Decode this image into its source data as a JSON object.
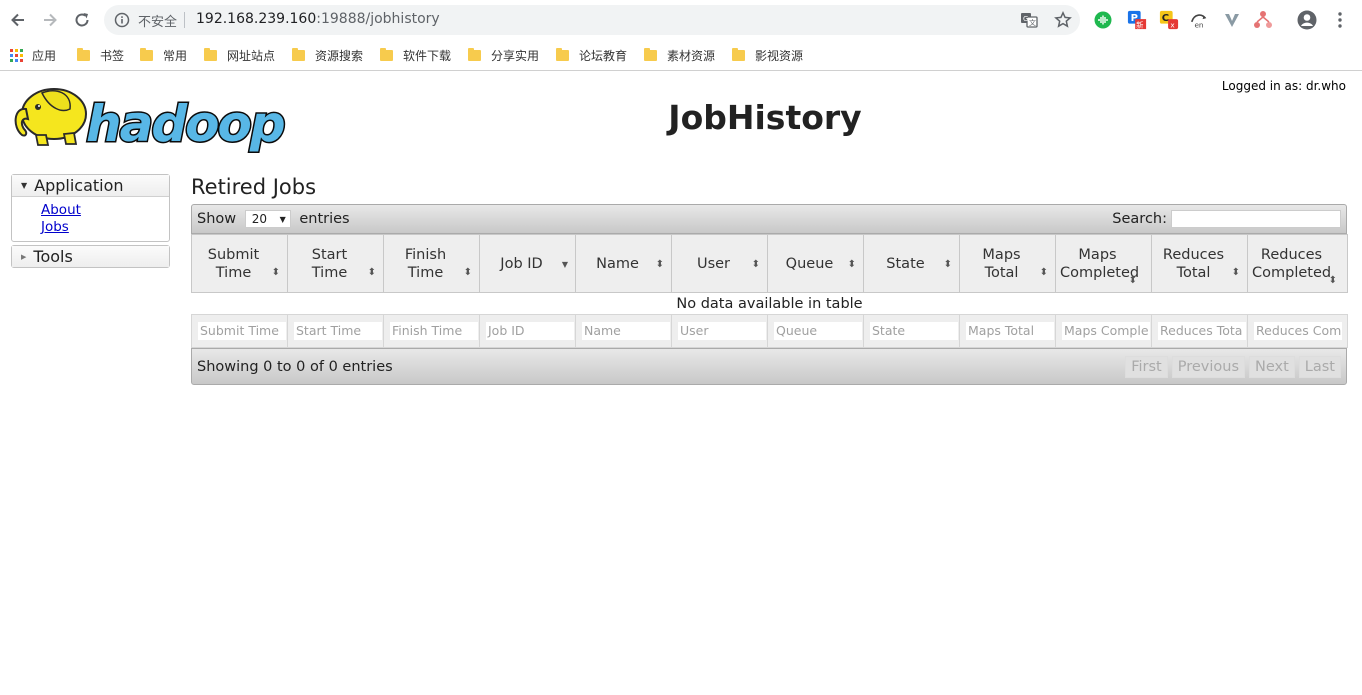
{
  "browser": {
    "security_label": "不安全",
    "url_host": "192.168.239.160",
    "url_rest": ":19888/jobhistory",
    "extensions": [
      "green-sound-extension-icon",
      "p-new-extension-icon",
      "c-red-x-extension-icon",
      "translate-en-extension-icon",
      "v-extension-icon",
      "network-extension-icon"
    ]
  },
  "bookmarks": [
    {
      "label": "应用",
      "icon": "apps-grid-icon"
    },
    {
      "label": "书签",
      "icon": "folder-icon"
    },
    {
      "label": "常用",
      "icon": "folder-icon"
    },
    {
      "label": "网址站点",
      "icon": "folder-icon"
    },
    {
      "label": "资源搜索",
      "icon": "folder-icon"
    },
    {
      "label": "软件下载",
      "icon": "folder-icon"
    },
    {
      "label": "分享实用",
      "icon": "folder-icon"
    },
    {
      "label": "论坛教育",
      "icon": "folder-icon"
    },
    {
      "label": "素材资源",
      "icon": "folder-icon"
    },
    {
      "label": "影视资源",
      "icon": "folder-icon"
    }
  ],
  "header": {
    "logo_text": "hadoop",
    "title": "JobHistory",
    "logged_in": "Logged in as: dr.who"
  },
  "nav": {
    "application": {
      "label": "Application",
      "links": [
        "About",
        "Jobs"
      ]
    },
    "tools": {
      "label": "Tools"
    }
  },
  "main": {
    "section_title": "Retired Jobs",
    "show_label": "Show",
    "page_length": "20",
    "entries_label": "entries",
    "search_label": "Search:",
    "search_value": "",
    "columns": [
      {
        "label": "Submit Time",
        "sort": "both"
      },
      {
        "label": "Start Time",
        "sort": "both"
      },
      {
        "label": "Finish Time",
        "sort": "both"
      },
      {
        "label": "Job ID",
        "sort": "desc"
      },
      {
        "label": "Name",
        "sort": "both"
      },
      {
        "label": "User",
        "sort": "both"
      },
      {
        "label": "Queue",
        "sort": "both"
      },
      {
        "label": "State",
        "sort": "both"
      },
      {
        "label": "Maps Total",
        "sort": "both"
      },
      {
        "label": "Maps Completed",
        "sort": "both"
      },
      {
        "label": "Reduces Total",
        "sort": "both"
      },
      {
        "label": "Reduces Completed",
        "sort": "both"
      }
    ],
    "empty_message": "No data available in table",
    "filter_placeholders": [
      "Submit Time",
      "Start Time",
      "Finish Time",
      "Job ID",
      "Name",
      "User",
      "Queue",
      "State",
      "Maps Total",
      "Maps Comple",
      "Reduces Tota",
      "Reduces Com"
    ],
    "info": "Showing 0 to 0 of 0 entries",
    "pager": [
      "First",
      "Previous",
      "Next",
      "Last"
    ]
  },
  "colors": {
    "link": "#0000cc",
    "hadoop_yellow": "#f5e61e",
    "hadoop_blue": "#58b7e6"
  }
}
